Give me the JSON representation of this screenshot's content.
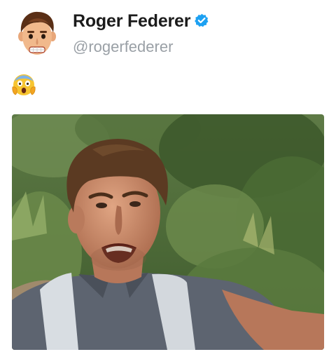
{
  "tweet": {
    "author": {
      "display_name": "Roger Federer",
      "handle": "@rogerfederer",
      "verified": true,
      "avatar_icon": "man-face-emoji-avatar"
    },
    "body": {
      "emoji": "screaming-in-fear-emoji"
    },
    "media": {
      "type": "photo",
      "subject": "selfie-grimace-in-forest"
    }
  },
  "colors": {
    "verified_badge": "#1da1f2",
    "handle_text": "#9aa0a6",
    "name_text": "#1b1b1b"
  }
}
